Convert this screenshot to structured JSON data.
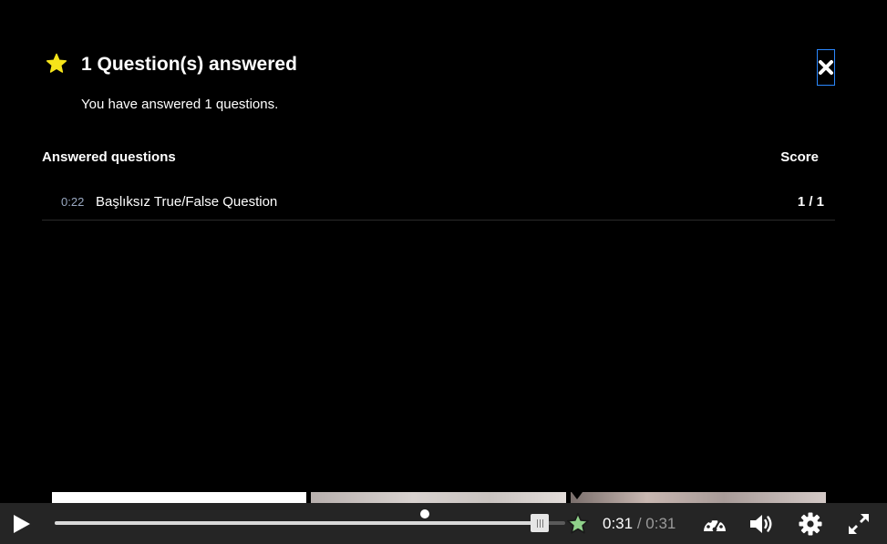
{
  "summary": {
    "title": "1 Question(s) answered",
    "subtitle": "You have answered 1 questions.",
    "close_icon": "close-icon",
    "table": {
      "col_questions": "Answered questions",
      "col_score": "Score",
      "rows": [
        {
          "time": "0:22",
          "title": "Başlıksız True/False Question",
          "score": "1 / 1"
        }
      ]
    }
  },
  "player": {
    "current_time": "0:31",
    "separator": "/",
    "duration": "0:31",
    "progress_fraction": 0.95,
    "bookmark_fraction": 0.725
  },
  "colors": {
    "star": "#f5e41a",
    "answered_star": "#8fd18a",
    "close_border": "#2b88ff"
  }
}
